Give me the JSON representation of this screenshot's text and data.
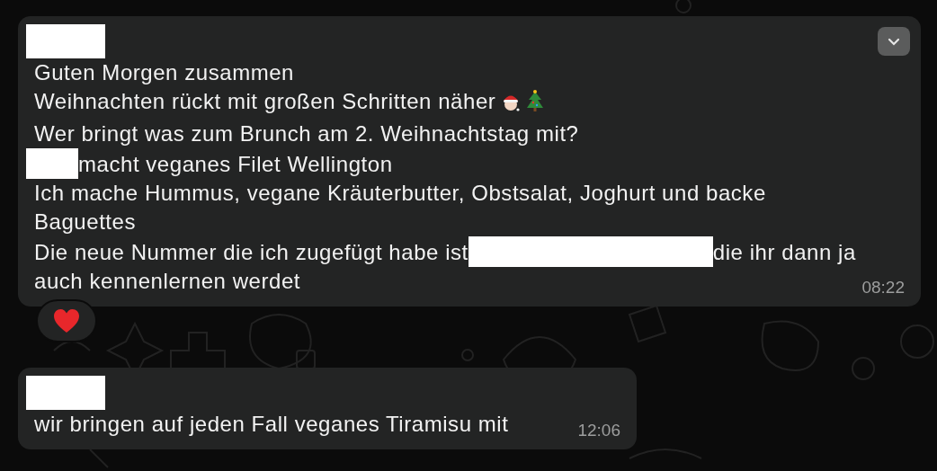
{
  "messages": [
    {
      "sender_redacted": true,
      "menu_button": true,
      "time": "08:22",
      "reacted": true,
      "lines": [
        {
          "segments": [
            {
              "kind": "text",
              "text": "Guten Morgen zusammen"
            }
          ]
        },
        {
          "segments": [
            {
              "kind": "text",
              "text": "Weihnachten rückt mit großen Schritten näher"
            },
            {
              "kind": "santa_emoji"
            },
            {
              "kind": "tree_emoji"
            }
          ]
        },
        {
          "segments": [
            {
              "kind": "text",
              "text": "Wer bringt was zum Brunch am 2. Weihnachtstag mit?"
            }
          ]
        },
        {
          "segments": [
            {
              "kind": "redacted_short"
            },
            {
              "kind": "text",
              "text": "macht veganes Filet Wellington"
            }
          ]
        },
        {
          "segments": [
            {
              "kind": "text",
              "text": "Ich mache Hummus, vegane Kräuterbutter, Obstsalat, Joghurt und backe"
            }
          ]
        },
        {
          "segments": [
            {
              "kind": "text",
              "text": "Baguettes"
            }
          ]
        },
        {
          "segments": [
            {
              "kind": "text",
              "text": "Die neue Nummer die ich zugefügt habe ist"
            },
            {
              "kind": "redacted_long"
            },
            {
              "kind": "text",
              "text": "die ihr dann ja"
            }
          ]
        },
        {
          "segments": [
            {
              "kind": "text",
              "text": "auch kennenlernen werdet"
            }
          ]
        }
      ]
    },
    {
      "sender_redacted": true,
      "menu_button": false,
      "time": "12:06",
      "reacted": false,
      "lines": [
        {
          "segments": [
            {
              "kind": "text",
              "text": "wir bringen auf jeden Fall veganes Tiramisu mit"
            }
          ]
        }
      ]
    }
  ]
}
